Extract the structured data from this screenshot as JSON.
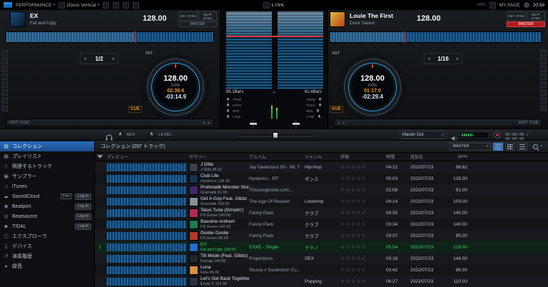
{
  "icons": {
    "dropdown": "▾",
    "prev": "◂",
    "next": "▸",
    "up": "▴"
  },
  "topbar": {
    "performance": "PERFORMANCE",
    "layout": "2Deck Vertical",
    "link": "LINK",
    "midi": "MIDI",
    "my_page": "MY PAGE",
    "clock": "20:59"
  },
  "deck1": {
    "title": "EX",
    "artist": "Fat and Ugly",
    "bpm": "128.00",
    "key_sync": "KEY SYNC",
    "beat_sync": "BEAT SYNC",
    "master": "MASTER",
    "int_label": "INT",
    "loop": "1/2",
    "jog_bpm": "128.00",
    "pitch": "0.0%",
    "elapsed": "02:39.4",
    "remain": "-03:14.9",
    "cue": "CUE",
    "hot_cue": "HOT CUE",
    "bars": "85.1Bars"
  },
  "deck2": {
    "title": "Louie The First",
    "artist": "Duck Sauce",
    "bpm": "128.00",
    "key_sync": "KEY SYNC",
    "beat_sync": "BEAT SYNC",
    "master": "MASTER",
    "int_label": "INT",
    "loop": "1/16",
    "jog_bpm": "128.00",
    "pitch": "0.0%",
    "elapsed": "01:17.0",
    "remain": "-02:29.4",
    "cue": "CUE",
    "hot_cue": "HOT CUE",
    "bars": "61.4Bars"
  },
  "mixer": {
    "trim": "TRIM",
    "high": "HIGH",
    "mid": "MID",
    "low": "LOW",
    "mix": "MIX",
    "level": "LEVEL",
    "master_out": "Master Out",
    "rec_times": "00:00:00 / 00:00:00"
  },
  "sidebar": {
    "items": [
      {
        "icon": "▤",
        "label": "コレクション",
        "active": true
      },
      {
        "icon": "▦",
        "label": "プレイリスト"
      },
      {
        "icon": "◇",
        "label": "関連するトラック"
      },
      {
        "icon": "▣",
        "label": "サンプラー"
      },
      {
        "icon": "♫",
        "label": "iTunes"
      },
      {
        "icon": "☁",
        "label": "SoundCloud",
        "badge": "Free",
        "action": "Log in"
      },
      {
        "icon": "◉",
        "label": "Beatport",
        "action": "Log in"
      },
      {
        "icon": "◎",
        "label": "Beatsource",
        "action": "Log in"
      },
      {
        "icon": "◆",
        "label": "TIDAL",
        "action": "Log in"
      },
      {
        "icon": "▢",
        "label": "エクスプローラ"
      },
      {
        "icon": "▯",
        "label": "デバイス"
      },
      {
        "icon": "↺",
        "label": "演奏履歴"
      },
      {
        "icon": "●",
        "label": "録音"
      }
    ]
  },
  "browser": {
    "title": "コレクション (297 トラック)",
    "master_select": "MASTER",
    "columns": [
      "プレビュー",
      "サマリー",
      "アルバム",
      "ジャンル",
      "評価",
      "時間",
      "追加日",
      "BPM"
    ],
    "rows": [
      {
        "title": "J Dilla",
        "artist": "J Dilla  96.62",
        "album": "Jay Deelicious 95 - 98: T",
        "genre": "Hip-Hop",
        "rating": "☆☆☆☆☆",
        "time": "04:12",
        "date": "2022/07/23",
        "bpm": "96.62",
        "art": "#3a3f46"
      },
      {
        "title": "Club Life",
        "artist": "Hysterics  128.00",
        "album": "Hysterics - EP",
        "genre": "ダンス",
        "rating": "☆☆☆☆☆",
        "time": "05:03",
        "date": "2022/07/23",
        "bpm": "128.00",
        "art": "#16324f"
      },
      {
        "title": "Probmatik Monster Stom",
        "artist": "Gramatik  91.00",
        "album": "Thissongissick.com...",
        "genre": "",
        "rating": "☆☆☆☆☆",
        "time": "02:08",
        "date": "2022/07/23",
        "bpm": "91.00",
        "art": "#45276b"
      },
      {
        "title": "Get A Grip Feat. Gibbz",
        "artist": "Gramatik  103.00",
        "album": "The Age Of Reason",
        "genre": "Lowtemp",
        "rating": "☆☆☆☆☆",
        "time": "04:14",
        "date": "2022/07/23",
        "bpm": "103.00",
        "art": "#8a8f96"
      },
      {
        "title": "Tetus Tune (Grindin')",
        "artist": "FS Green  140.00",
        "album": "Fanny Pack",
        "genre": "クラブ",
        "rating": "☆☆☆☆☆",
        "time": "04:30",
        "date": "2022/07/23",
        "bpm": "140.00",
        "art": "#b3285a"
      },
      {
        "title": "Bassline Anthem",
        "artist": "FS Green  140.00",
        "album": "Fanny Pack",
        "genre": "クラブ",
        "rating": "☆☆☆☆☆",
        "time": "03:34",
        "date": "2022/07/23",
        "bpm": "140.00",
        "art": "#1f7a4d"
      },
      {
        "title": "Goolie Goolie",
        "artist": "FS Green  85.00",
        "album": "Fanny Pack",
        "genre": "クラブ",
        "rating": "☆☆☆☆☆",
        "time": "03:37",
        "date": "2022/07/23",
        "bpm": "85.00",
        "art": "#b03a2e"
      },
      {
        "num": "1",
        "playing": true,
        "title": "EX",
        "artist": "Fat and Ugly  128.00",
        "album": "EXXE - Single",
        "genre": "テクノ",
        "rating": "☆☆☆☆☆",
        "time": "05:54",
        "date": "2022/07/23",
        "bpm": "128.00",
        "art": "#1d6fd1"
      },
      {
        "title": "Tilt Mode (Feat. Gibbz)",
        "artist": "Exmag  144.00",
        "album": "Proportions",
        "genre": "SEX",
        "rating": "☆☆☆☆☆",
        "time": "03:18",
        "date": "2022/07/23",
        "bpm": "144.00",
        "art": "#23272e"
      },
      {
        "title": "Luna",
        "artist": "Esta  86.00",
        "album": "Stussy x Soulection Co...",
        "genre": "",
        "rating": "☆☆☆☆☆",
        "time": "03:42",
        "date": "2022/07/23",
        "bpm": "86.00",
        "art": "#d99038"
      },
      {
        "title": "Let's Get Back Together",
        "artist": "Enois S  110.00",
        "album": "",
        "genre": "Popping",
        "rating": "☆☆☆☆☆",
        "time": "06:27",
        "date": "2022/07/23",
        "bpm": "110.00",
        "art": "#2c3340"
      }
    ]
  }
}
